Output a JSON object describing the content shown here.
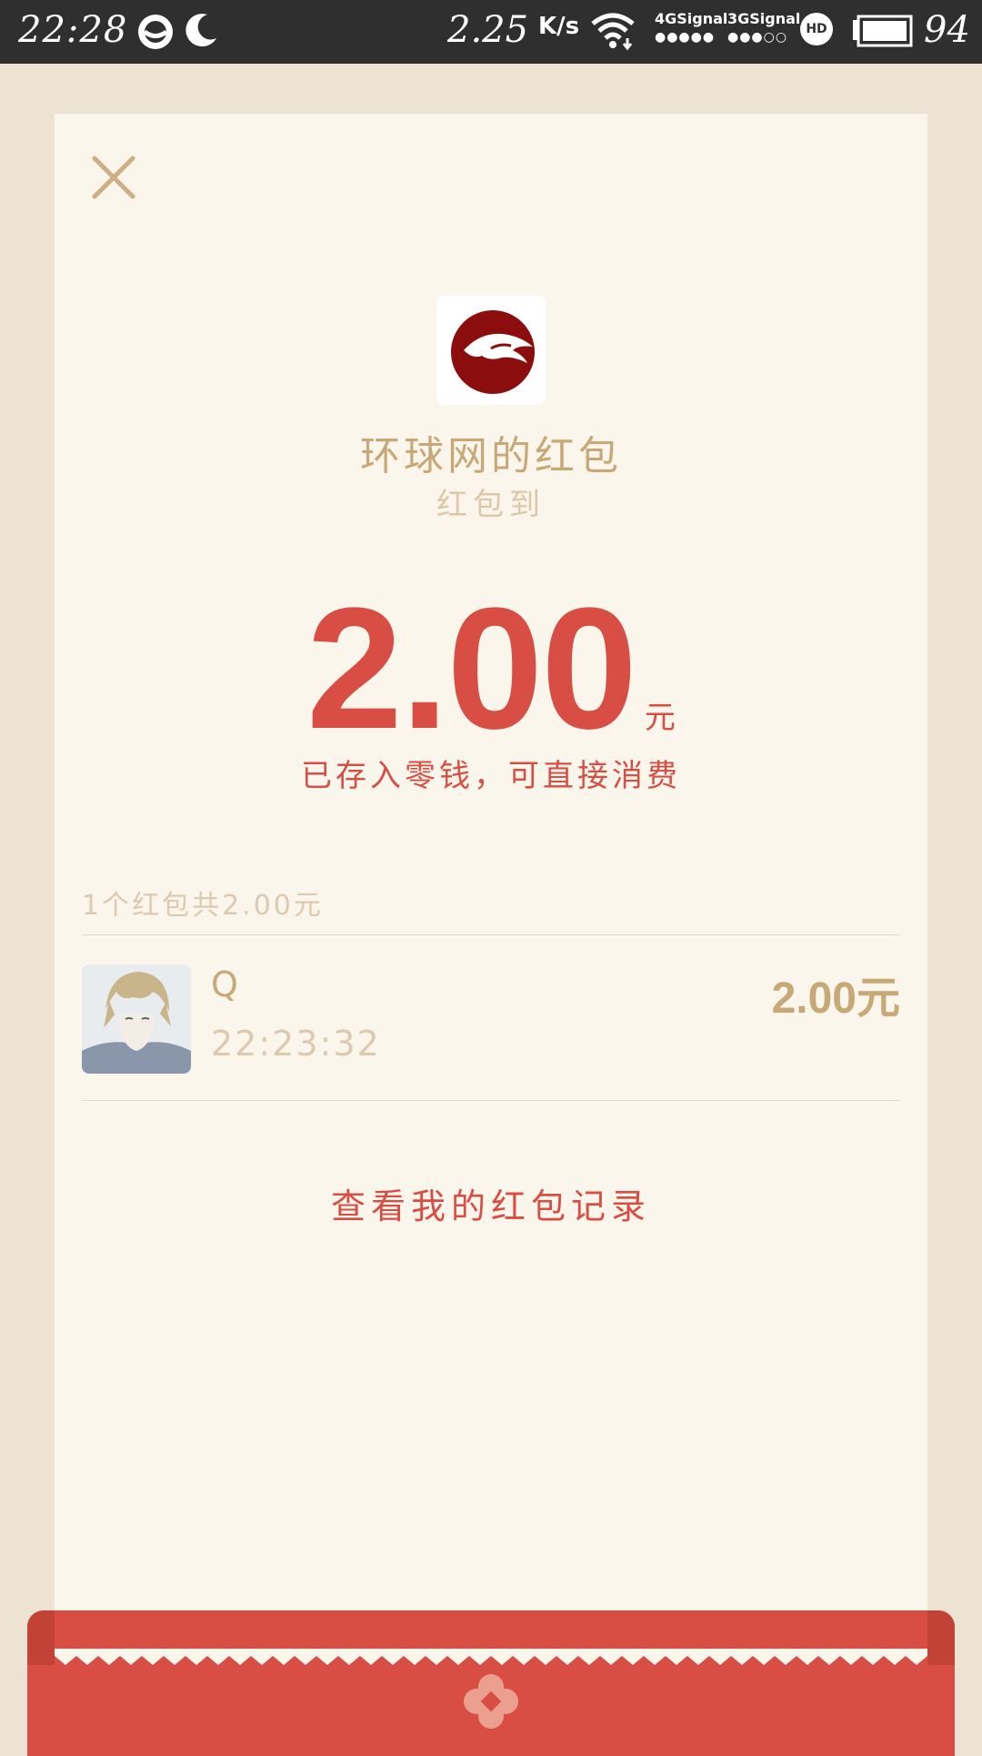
{
  "status_bar": {
    "time": "22:28",
    "speed": "2.25",
    "speed_unit": "K/s",
    "signal_1_label": "4GSignal",
    "signal_1_dots": "●●●●●",
    "signal_2_label": "3GSignal",
    "signal_2_dots": "●●●○○",
    "hd_label": "HD",
    "battery_level": "94",
    "icons": [
      "chat-icon",
      "moon-icon",
      "wifi-icon",
      "hd-icon",
      "battery-icon"
    ]
  },
  "packet": {
    "sender_title": "环球网的红包",
    "status": "红包到",
    "amount": "2.00",
    "amount_unit": "元",
    "note": "已存入零钱，可直接消费"
  },
  "summary": "1个红包共2.00元",
  "recipients": [
    {
      "name": "Q",
      "time": "22:23:32",
      "amount": "2.00元"
    }
  ],
  "records_link": "查看我的红包记录",
  "colors": {
    "accent_red": "#d84e44",
    "gold": "#c9a878",
    "card_bg": "#faf6ec",
    "page_bg": "#ece3d2"
  }
}
